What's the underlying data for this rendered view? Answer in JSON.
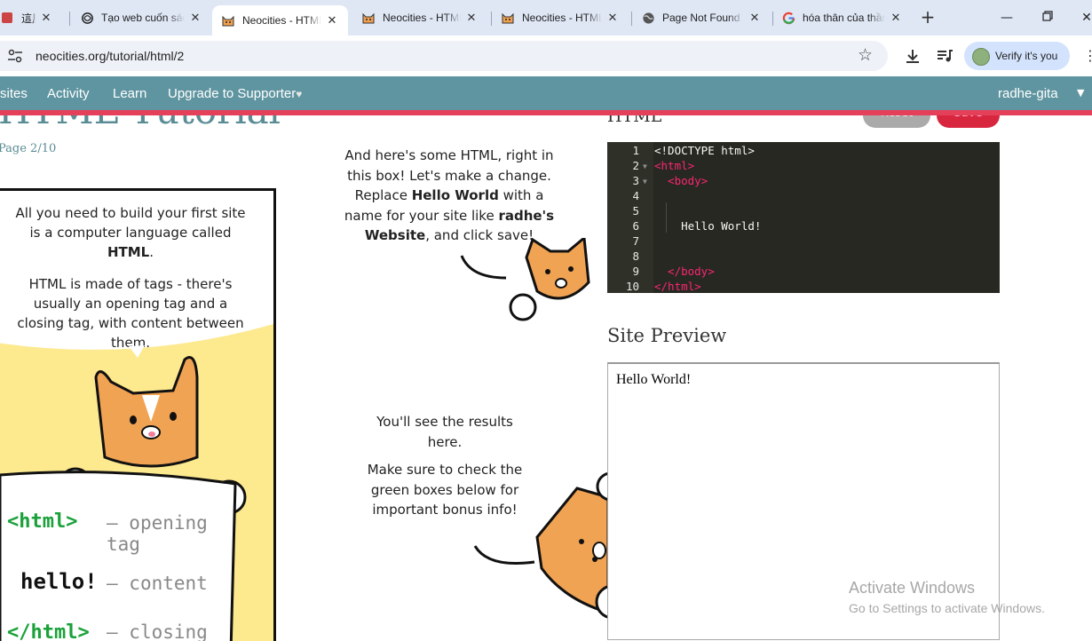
{
  "browser": {
    "tabs": [
      {
        "title": "這風了頁我",
        "icon": "generic-tab-icon"
      },
      {
        "title": "Tạo web cuốn sách",
        "icon": "chatgpt-icon"
      },
      {
        "title": "Neocities - HTML",
        "icon": "neocities-cat-icon",
        "active": true
      },
      {
        "title": "Neocities - HTML",
        "icon": "neocities-cat-icon"
      },
      {
        "title": "Neocities - HTML",
        "icon": "neocities-cat-icon"
      },
      {
        "title": "Page Not Found",
        "icon": "globe-icon"
      },
      {
        "title": "hóa thân của thần",
        "icon": "google-icon"
      }
    ],
    "url": "neocities.org/tutorial/html/2",
    "profile_label": "Verify it's you"
  },
  "nav": {
    "items": [
      "sites",
      "Activity",
      "Learn",
      "Upgrade to Supporter"
    ],
    "user": "radhe-gita"
  },
  "tutorial": {
    "title": "HTML Tutorial",
    "page": "Page 2/10",
    "comic_text_1": "All you need to build your first site is a computer language called HTML.",
    "comic_text_1_pre": "All you need to build your first site is a computer language called ",
    "comic_text_1_bold": "HTML",
    "comic_text_1_post": ".",
    "comic_text_2": "HTML is made of tags - there's usually an opening tag and a closing tag, with content between them.",
    "sign_lines": [
      {
        "code": "<html>",
        "desc": "opening tag"
      },
      {
        "code": "hello!",
        "desc": "content"
      },
      {
        "code": "</html>",
        "desc": "closing"
      }
    ],
    "mid_1": {
      "a": "And here's some HTML, right in this box! Let's make a change. Replace ",
      "b": "Hello World",
      "c": " with a name for your site like ",
      "d": "radhe's Website",
      "e": ", and click save!"
    },
    "mid_2": "You'll see the results here.",
    "mid_3": "Make sure to check the green boxes below for important bonus info!"
  },
  "editor": {
    "label": "HTML",
    "reset_label": "Reset",
    "save_label": "Save",
    "lines": [
      {
        "n": "1",
        "code": "<!DOCTYPE html>"
      },
      {
        "n": "2",
        "code": "<html>"
      },
      {
        "n": "3",
        "code": "  <body>"
      },
      {
        "n": "4",
        "code": ""
      },
      {
        "n": "5",
        "code": ""
      },
      {
        "n": "6",
        "code": "    Hello World!"
      },
      {
        "n": "7",
        "code": ""
      },
      {
        "n": "8",
        "code": ""
      },
      {
        "n": "9",
        "code": "  </body>"
      },
      {
        "n": "10",
        "code": "</html>"
      }
    ]
  },
  "preview": {
    "label": "Site Preview",
    "content": "Hello World!"
  },
  "watermark": {
    "title": "Activate Windows",
    "subtitle": "Go to Settings to activate Windows."
  },
  "colors": {
    "nav_bg": "#5f95a0",
    "accent_red": "#e4405a",
    "editor_bg": "#272822",
    "tag_color": "#f92672"
  }
}
